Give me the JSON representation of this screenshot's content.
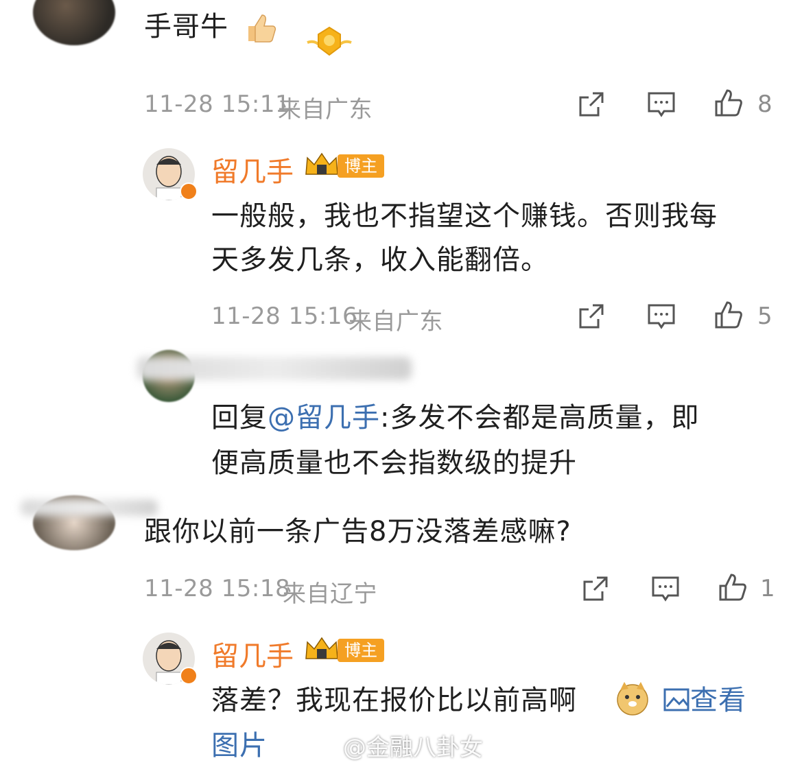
{
  "comments": [
    {
      "text": "手哥牛",
      "time": "11-28 15:11",
      "location": "来自广东",
      "likes": "8"
    },
    {
      "username": "留几手",
      "badge": "博主",
      "text_line1": "一般般，我也不指望这个赚钱。否则我每",
      "text_line2": "天多发几条，收入能翻倍。",
      "time": "11-28 15:16",
      "location": "来自广东",
      "likes": "5"
    },
    {
      "reply_prefix": "回复",
      "mention": "@留几手",
      "text_line1_rest": ":多发不会都是高质量，即",
      "text_line2": "便高质量也不会指数级的提升"
    },
    {
      "text": "跟你以前一条广告8万没落差感嘛?",
      "time": "11-28 15:18",
      "location": "来自辽宁",
      "likes": "1"
    },
    {
      "username": "留几手",
      "badge": "博主",
      "text_line1": "落差？我现在报价比以前高啊",
      "view_image": "查看",
      "text_line2": "图片"
    }
  ],
  "watermark": "@金融八卦女",
  "colors": {
    "username": "#f07a2a",
    "link": "#3c6fb0",
    "badge": "#f5a022",
    "meta": "#9a9a9a"
  }
}
